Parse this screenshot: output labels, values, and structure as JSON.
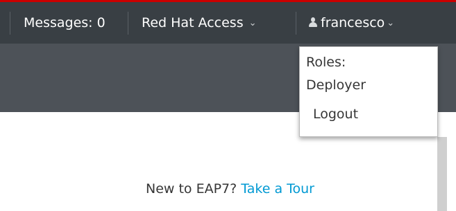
{
  "header": {
    "messages_label": "Messages: 0",
    "red_hat_access_label": "Red Hat Access",
    "user_label": "francesco",
    "caret_icon": "chevron-down-icon",
    "user_icon": "user-icon"
  },
  "user_menu": {
    "roles_label": "Roles:",
    "role_value": "Deployer",
    "logout_label": "Logout"
  },
  "main": {
    "tour_prompt": "New to EAP7?",
    "tour_link": "Take a Tour"
  },
  "colors": {
    "accent": "#cc0000",
    "topbar": "#393f44",
    "subbar": "#4d5258",
    "link": "#0099d3"
  }
}
